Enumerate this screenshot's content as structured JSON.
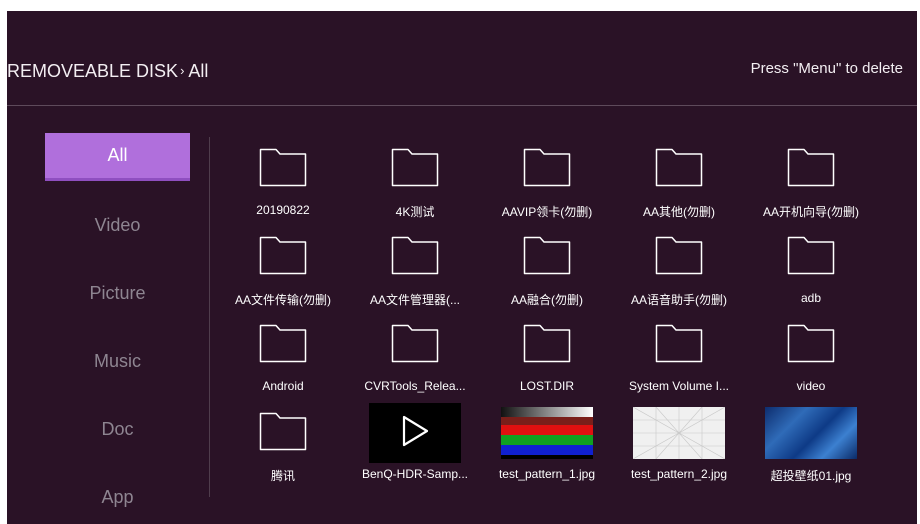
{
  "header": {
    "source": "REMOVEABLE DISK",
    "separator": "›",
    "current": "All",
    "hint": "Press \"Menu\" to delete"
  },
  "sidebar": {
    "items": [
      {
        "label": "All",
        "active": true
      },
      {
        "label": "Video",
        "active": false
      },
      {
        "label": "Picture",
        "active": false
      },
      {
        "label": "Music",
        "active": false
      },
      {
        "label": "Doc",
        "active": false
      },
      {
        "label": "App",
        "active": false
      }
    ]
  },
  "files": [
    {
      "label": "20190822",
      "type": "folder"
    },
    {
      "label": "4K测试",
      "type": "folder"
    },
    {
      "label": "AAVIP领卡(勿删)",
      "type": "folder"
    },
    {
      "label": "AA其他(勿删)",
      "type": "folder"
    },
    {
      "label": "AA开机向导(勿删)",
      "type": "folder"
    },
    {
      "label": "AA文件传输(勿删)",
      "type": "folder"
    },
    {
      "label": "AA文件管理器(...",
      "type": "folder"
    },
    {
      "label": "AA融合(勿删)",
      "type": "folder"
    },
    {
      "label": "AA语音助手(勿删)",
      "type": "folder"
    },
    {
      "label": "adb",
      "type": "folder"
    },
    {
      "label": "Android",
      "type": "folder"
    },
    {
      "label": "CVRTools_Relea...",
      "type": "folder"
    },
    {
      "label": "LOST.DIR",
      "type": "folder"
    },
    {
      "label": "System Volume I...",
      "type": "folder"
    },
    {
      "label": "video",
      "type": "folder"
    },
    {
      "label": "腾讯",
      "type": "folder"
    },
    {
      "label": "BenQ-HDR-Samp...",
      "type": "video"
    },
    {
      "label": "test_pattern_1.jpg",
      "type": "pattern1"
    },
    {
      "label": "test_pattern_2.jpg",
      "type": "pattern2"
    },
    {
      "label": "超投壁纸01.jpg",
      "type": "wallpaper"
    }
  ],
  "colors": {
    "background": "#2a1226",
    "accent": "#b06fdc",
    "inactive_text": "#8e8591"
  }
}
